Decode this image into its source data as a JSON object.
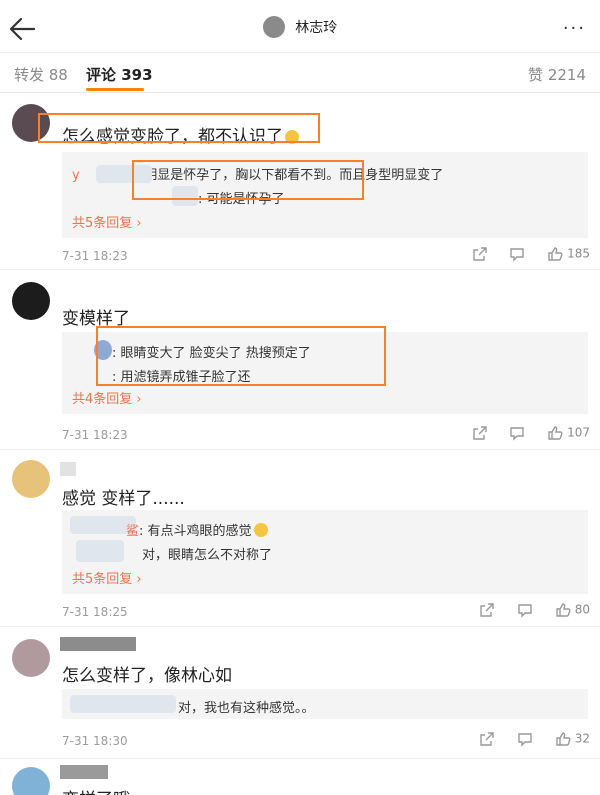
{
  "header": {
    "title": "林志玲",
    "more": "···"
  },
  "tabs": {
    "repost": "转发 88",
    "comments": "评论 393",
    "likes": "赞 2214"
  },
  "colors": {
    "accent": "#ff8200",
    "highlight": "#f5812d",
    "reply_name": "#eb7350"
  },
  "comments": [
    {
      "text": "怎么感觉变脸了，都不认识了",
      "replies": [
        {
          "name": "y",
          "text": "明显是怀孕了，胸以下都看不到。而且身型明显变了"
        },
        {
          "name": "",
          "text": "可能是怀孕了"
        }
      ],
      "more_replies": "共5条回复 ›",
      "time": "7-31 18:23",
      "likes": "185"
    },
    {
      "text": "变模样了",
      "replies": [
        {
          "name": "",
          "text": "眼睛变大了 脸变尖了 热搜预定了"
        },
        {
          "name": "",
          "text": "用滤镜弄成锥子脸了还"
        }
      ],
      "more_replies": "共4条回复 ›",
      "time": "7-31 18:23",
      "likes": "107"
    },
    {
      "text": "感觉 变样了......",
      "replies": [
        {
          "name": "鲨",
          "text": "有点斗鸡眼的感觉"
        },
        {
          "name": "",
          "text": "对，眼睛怎么不对称了"
        }
      ],
      "more_replies": "共5条回复 ›",
      "time": "7-31 18:25",
      "likes": "80"
    },
    {
      "text": "怎么变样了，像林心如",
      "replies": [
        {
          "name": "",
          "text": "对，我也有这种感觉。。"
        }
      ],
      "time": "7-31 18:30",
      "likes": "32"
    },
    {
      "text": "变样了哦"
    }
  ]
}
